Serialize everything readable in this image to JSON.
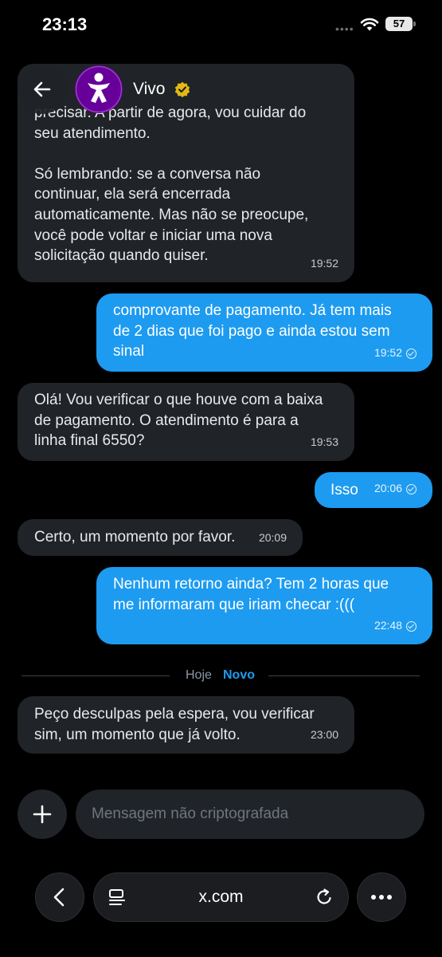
{
  "status_bar": {
    "time": "23:13",
    "battery": "57",
    "signal_dots": "••••"
  },
  "header": {
    "contact_name": "Vivo"
  },
  "messages": [
    {
      "text": "precisar. A partir de agora, vou cuidar do\nseu atendimento.\n\nSó lembrando: se a conversa não\ncontinuar, ela será encerrada\nautomaticamente. Mas não se preocupe,\nvocê pode voltar e iniciar uma nova\nsolicitação quando quiser.",
      "time": "19:52"
    },
    {
      "text": "comprovante de pagamento. Já tem mais\nde 2 dias que foi pago e ainda estou sem\nsinal",
      "time": "19:52"
    },
    {
      "text": "Olá! Vou verificar o que houve com a baixa\nde pagamento. O atendimento é para a\nlinha final 6550?",
      "time": "19:53"
    },
    {
      "text": "Isso",
      "time": "20:06"
    },
    {
      "text": "Certo, um momento por favor.",
      "time": "20:09"
    },
    {
      "text": "Nenhum retorno ainda? Tem 2 horas que\nme informaram que iriam checar :(((",
      "time": "22:48"
    },
    {
      "text": "Peço desculpas pela espera, vou verificar\nsim, um momento que já volto.",
      "time": "23:00"
    }
  ],
  "separator": {
    "day": "Hoje",
    "new_label": "Novo"
  },
  "composer": {
    "placeholder": "Mensagem não criptografada"
  },
  "browser": {
    "url": "x.com"
  }
}
